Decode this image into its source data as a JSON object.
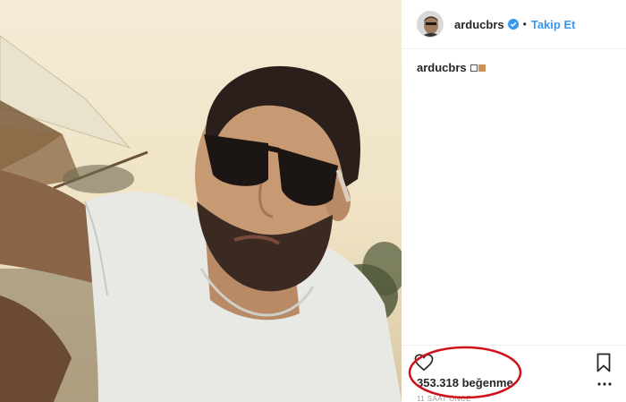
{
  "post": {
    "username": "arducbrs",
    "follow_label": "Takip Et",
    "separator": "•",
    "caption_user": "arducbrs",
    "caption_emoji": [
      "white-square-emoji",
      "brown-square-emoji"
    ],
    "likes": "353.318 beğenme",
    "time_ago": "11 SAAT ÖNCE"
  },
  "icons": {
    "verified": "verified-badge-icon",
    "like": "heart-outline-icon",
    "save": "bookmark-outline-icon",
    "more": "more-options-icon"
  },
  "colors": {
    "link_blue": "#3897f0",
    "verified_blue": "#3897f0",
    "annotation_red": "#d0101a",
    "text": "#262626",
    "muted": "#999999"
  }
}
